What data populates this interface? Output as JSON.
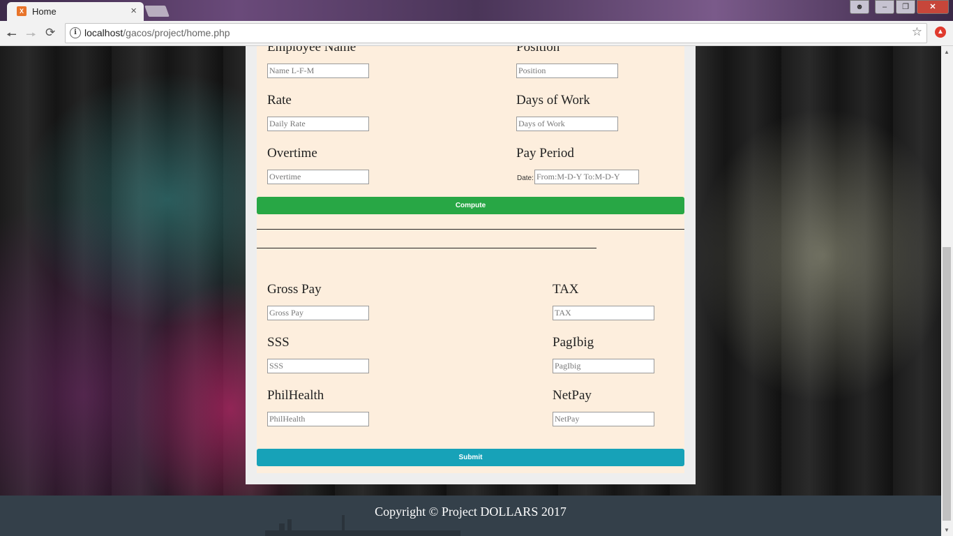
{
  "browser": {
    "tab_title": "Home",
    "tab_close": "×",
    "favicon": "X",
    "url_host": "localhost",
    "url_path": "/gacos/project/home.php",
    "icons": [
      "back-icon",
      "forward-icon",
      "reload-icon",
      "info-icon",
      "star-icon",
      "extension-icon"
    ]
  },
  "form": {
    "employee_name": {
      "label": "Employee Name",
      "placeholder": "Name L-F-M"
    },
    "position": {
      "label": "Position",
      "placeholder": "Position"
    },
    "rate": {
      "label": "Rate",
      "placeholder": "Daily Rate"
    },
    "days_of_work": {
      "label": "Days of Work",
      "placeholder": "Days of Work"
    },
    "overtime": {
      "label": "Overtime",
      "placeholder": "Overtime"
    },
    "pay_period": {
      "label": "Pay Period",
      "date_label": "Date:",
      "placeholder": "From:M-D-Y To:M-D-Y"
    },
    "compute_label": "Compute",
    "gross_pay": {
      "label": "Gross Pay",
      "placeholder": "Gross Pay"
    },
    "tax": {
      "label": "TAX",
      "placeholder": "TAX"
    },
    "sss": {
      "label": "SSS",
      "placeholder": "SSS"
    },
    "pagibig": {
      "label": "PagIbig",
      "placeholder": "PagIbig"
    },
    "philhealth": {
      "label": "PhilHealth",
      "placeholder": "PhilHealth"
    },
    "netpay": {
      "label": "NetPay",
      "placeholder": "NetPay"
    },
    "submit_label": "Submit"
  },
  "footer": {
    "copyright": "Copyright © Project DOLLARS 2017"
  }
}
